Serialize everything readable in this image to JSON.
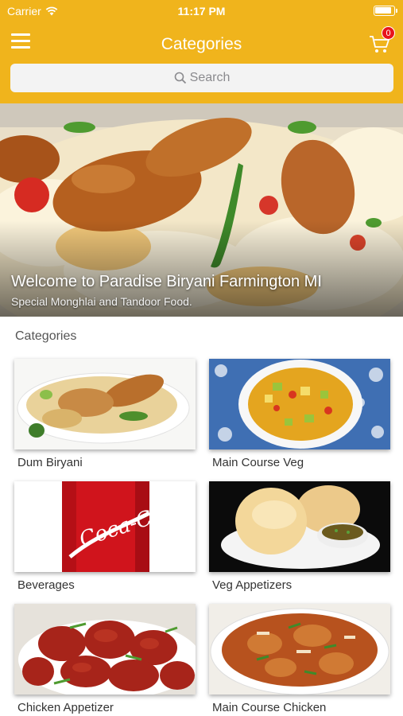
{
  "status_bar": {
    "carrier": "Carrier",
    "time": "11:17 PM"
  },
  "nav": {
    "title": "Categories",
    "cart_count": "0"
  },
  "search": {
    "placeholder": "Search"
  },
  "hero": {
    "title": "Welcome to Paradise Biryani Farmington MI",
    "subtitle": "Special Monghlai and Tandoor Food."
  },
  "section_title": "Categories",
  "categories": [
    {
      "label": "Dum Biryani"
    },
    {
      "label": "Main Course Veg"
    },
    {
      "label": "Beverages"
    },
    {
      "label": "Veg Appetizers"
    },
    {
      "label": "Chicken Appetizer"
    },
    {
      "label": "Main Course Chicken"
    }
  ],
  "colors": {
    "brand": "#f0b41c",
    "badge": "#e8141b"
  }
}
